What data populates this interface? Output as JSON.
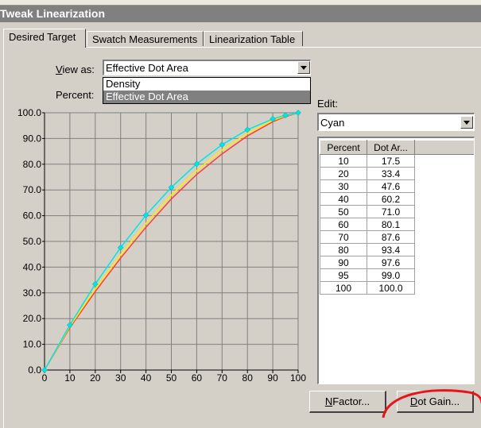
{
  "window": {
    "title": "Tweak Linearization"
  },
  "tabs": [
    {
      "label": "Desired Target"
    },
    {
      "label": "Swatch Measurements"
    },
    {
      "label": "Linearization Table"
    }
  ],
  "view_as": {
    "label": "View as:",
    "value": "Effective Dot Area",
    "options": [
      "Density",
      "Effective Dot Area"
    ],
    "selected_index": 1
  },
  "percent_label": "Percent:",
  "edit": {
    "label": "Edit:",
    "value": "Cyan"
  },
  "table": {
    "headers": [
      "Percent",
      "Dot Ar..."
    ],
    "rows": [
      [
        "10",
        "17.5"
      ],
      [
        "20",
        "33.4"
      ],
      [
        "30",
        "47.6"
      ],
      [
        "40",
        "60.2"
      ],
      [
        "50",
        "71.0"
      ],
      [
        "60",
        "80.1"
      ],
      [
        "70",
        "87.6"
      ],
      [
        "80",
        "93.4"
      ],
      [
        "90",
        "97.6"
      ],
      [
        "95",
        "99.0"
      ],
      [
        "100",
        "100.0"
      ]
    ]
  },
  "buttons": {
    "nfactor": "NFactor...",
    "dot_gain": "Dot Gain..."
  },
  "colors": {
    "cyan": "#00e5e5",
    "red": "#ff3b3b",
    "yellow": "#ffee00",
    "annotation": "#e8141c"
  },
  "chart_data": {
    "type": "line",
    "x": [
      0,
      10,
      20,
      30,
      40,
      50,
      60,
      70,
      80,
      90,
      95,
      100
    ],
    "xlim": [
      0,
      100
    ],
    "ylim": [
      0,
      100
    ],
    "x_ticks": [
      "0",
      "10",
      "20",
      "30",
      "40",
      "50",
      "60",
      "70",
      "80",
      "90",
      "100"
    ],
    "y_ticks": [
      "0.0",
      "10.0",
      "20.0",
      "30.0",
      "40.0",
      "50.0",
      "60.0",
      "70.0",
      "80.0",
      "90.0",
      "100.0"
    ],
    "grid": true,
    "series": [
      {
        "color": "#00e5e5",
        "values": [
          0,
          17.5,
          33.4,
          47.6,
          60.2,
          71.0,
          80.1,
          87.6,
          93.4,
          97.6,
          99.0,
          100.0
        ],
        "markers": true
      },
      {
        "color": "#ff3b3b",
        "values": [
          0,
          16.5,
          30.5,
          43.5,
          55.5,
          66.5,
          76.0,
          84.0,
          91.0,
          96.5,
          98.5,
          100.0
        ],
        "markers": false
      },
      {
        "color": "#ffee00",
        "values": [
          0,
          17.0,
          31.5,
          44.8,
          57.0,
          68.0,
          77.5,
          85.5,
          92.0,
          97.0,
          98.8,
          100.0
        ],
        "markers": false
      }
    ]
  }
}
